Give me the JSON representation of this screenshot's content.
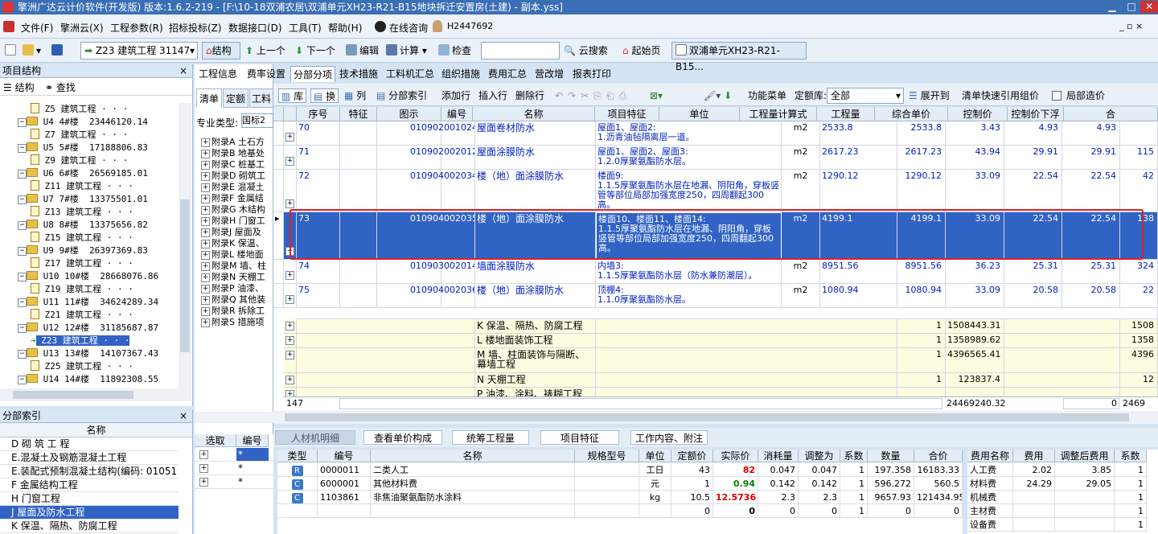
{
  "title": "擎洲广达云计价软件(开发版) 版本:1.6.2-219 - [F:\\10-18双浦农居\\双浦单元XH23-R21-B15地块拆迁安置房(土建) - 副本.yss]",
  "menu": [
    "文件(F)",
    "擎洲云(X)",
    "工程参数(R)",
    "招标投标(Z)",
    "数据接口(D)",
    "工具(T)",
    "帮助(H)",
    "在线咨询",
    "H2447692"
  ],
  "toolbar": {
    "project_select": "Z23 建筑工程 31147",
    "structure": "结构",
    "up": "上一个",
    "down": "下一个",
    "edit": "编辑",
    "calc": "计算",
    "check": "检查",
    "cloud_search": "云搜索",
    "home": "起始页",
    "doc_tab": "双浦单元XH23-R21-B15..."
  },
  "left_panel": {
    "title": "项目结构",
    "close": "×",
    "structure_btn": "结构",
    "find_btn": "查找",
    "tree": [
      {
        "code": "Z5",
        "name": "建筑工程",
        "amount": "· · ·",
        "indent": 3,
        "type": "doc"
      },
      {
        "code": "U4",
        "name": "4#楼",
        "amount": "23446120.14",
        "indent": 2,
        "type": "fld"
      },
      {
        "code": "Z7",
        "name": "建筑工程",
        "amount": "· · ·",
        "indent": 3,
        "type": "doc"
      },
      {
        "code": "U5",
        "name": "5#楼",
        "amount": "17188806.83",
        "indent": 2,
        "type": "fld"
      },
      {
        "code": "Z9",
        "name": "建筑工程",
        "amount": "· · ·",
        "indent": 3,
        "type": "doc"
      },
      {
        "code": "U6",
        "name": "6#楼",
        "amount": "26569185.01",
        "indent": 2,
        "type": "fld"
      },
      {
        "code": "Z11",
        "name": "建筑工程",
        "amount": "· · ·",
        "indent": 3,
        "type": "doc"
      },
      {
        "code": "U7",
        "name": "7#楼",
        "amount": "13375501.01",
        "indent": 2,
        "type": "fld"
      },
      {
        "code": "Z13",
        "name": "建筑工程",
        "amount": "· · ·",
        "indent": 3,
        "type": "doc"
      },
      {
        "code": "U8",
        "name": "8#楼",
        "amount": "13375656.82",
        "indent": 2,
        "type": "fld"
      },
      {
        "code": "Z15",
        "name": "建筑工程",
        "amount": "· · ·",
        "indent": 3,
        "type": "doc"
      },
      {
        "code": "U9",
        "name": "9#楼",
        "amount": "26397369.83",
        "indent": 2,
        "type": "fld"
      },
      {
        "code": "Z17",
        "name": "建筑工程",
        "amount": "· · ·",
        "indent": 3,
        "type": "doc"
      },
      {
        "code": "U10",
        "name": "10#楼",
        "amount": "28668076.86",
        "indent": 2,
        "type": "fld"
      },
      {
        "code": "Z19",
        "name": "建筑工程",
        "amount": "· · ·",
        "indent": 3,
        "type": "doc"
      },
      {
        "code": "U11",
        "name": "11#楼",
        "amount": "34624289.34",
        "indent": 2,
        "type": "fld"
      },
      {
        "code": "Z21",
        "name": "建筑工程",
        "amount": "· · ·",
        "indent": 3,
        "type": "doc"
      },
      {
        "code": "U12",
        "name": "12#楼",
        "amount": "31185687.87",
        "indent": 2,
        "type": "fld"
      },
      {
        "code": "Z23",
        "name": "建筑工程",
        "amount": "· · ·",
        "indent": 3,
        "type": "sel"
      },
      {
        "code": "U13",
        "name": "13#楼",
        "amount": "14107367.43",
        "indent": 2,
        "type": "fld"
      },
      {
        "code": "Z25",
        "name": "建筑工程",
        "amount": "· · ·",
        "indent": 3,
        "type": "doc"
      },
      {
        "code": "U14",
        "name": "14#楼",
        "amount": "11892308.55",
        "indent": 2,
        "type": "fld"
      }
    ]
  },
  "index_panel": {
    "title": "分部索引",
    "close": "×",
    "header": "名称",
    "rows": [
      "D 砌 筑 工 程",
      "E.混凝土及钢筋混凝土工程",
      "E.装配式预制混凝土结构(编码: 01051",
      "F 金属结构工程",
      "H 门窗工程",
      "J 屋面及防水工程",
      "K 保温、隔热、防腐工程"
    ],
    "selected": 5
  },
  "mid_panel": {
    "tabs": [
      "清单",
      "定额",
      "工料"
    ],
    "prof_label": "专业类型:",
    "prof_value": "国标2",
    "appendix": [
      "附录A 土石方",
      "附录B 地基处",
      "附录C 桩基工",
      "附录D 砌筑工",
      "附录E 混凝土",
      "附录F 金属结",
      "附录G 木结构",
      "附录H 门窗工",
      "附录J 屋面及",
      "附录K 保温、",
      "附录L 楼地面",
      "附录M 墙、柱",
      "附录N 天棚工",
      "附录P 油漆、",
      "附录Q 其他装",
      "附录R 拆除工",
      "附录S 措施项"
    ],
    "choose_header": [
      "选取",
      "编号"
    ],
    "choose_rows": [
      "*",
      "*",
      "*"
    ]
  },
  "main_tabs": [
    "工程信息",
    "费率设置",
    "分部分项",
    "技术措施",
    "工料机汇总",
    "组织措施",
    "费用汇总",
    "营改增",
    "报表打印"
  ],
  "main_tab_active": 2,
  "tb2": {
    "lib": "库",
    "swap": "换",
    "col": "列",
    "index": "分部索引",
    "add": "添加行",
    "insert": "插入行",
    "delete": "删除行",
    "func_menu": "功能菜单",
    "quota_lib_label": "定额库:",
    "quota_lib_value": "全部",
    "expand": "展开到",
    "quick_ref": "清单快速引用组价",
    "local_cost": "局部造价"
  },
  "grid": {
    "headers": [
      "序号",
      "特征",
      "图示",
      "编号",
      "名称",
      "项目特征",
      "单位",
      "工程量计算式",
      "工程量",
      "综合单价",
      "控制价",
      "控制价下浮",
      "合"
    ],
    "rows": [
      {
        "no": "70",
        "code": "010902001024",
        "name": "屋面卷材防水",
        "feature": "屋面1、屋面2:\n1.沥青油毡隔离层一道。",
        "unit": "m2",
        "formula": "2533.8",
        "qty": "2533.8",
        "price": "3.43",
        "ctrl": "4.93",
        "ctrl_down": "4.93",
        "total": ""
      },
      {
        "no": "71",
        "code": "010902002012",
        "name": "屋面涂膜防水",
        "feature": "屋面1、屋面2、屋面3:\n1.2.0厚聚氨酯防水层。",
        "unit": "m2",
        "formula": "2617.23",
        "qty": "2617.23",
        "price": "43.94",
        "ctrl": "29.91",
        "ctrl_down": "29.91",
        "total": "115"
      },
      {
        "no": "72",
        "code": "010904002034",
        "name": "楼（地）面涂膜防水",
        "feature": "楼面9:\n1.1.5厚聚氨酯防水层在地漏、阴阳角，穿板竖管等部位局部加强宽度250，四周翻起300高。",
        "unit": "m2",
        "formula": "1290.12",
        "qty": "1290.12",
        "price": "33.09",
        "ctrl": "22.54",
        "ctrl_down": "22.54",
        "total": "42"
      },
      {
        "no": "73",
        "code": "010904002035",
        "name": "楼（地）面涂膜防水",
        "feature": "楼面10、楼面11、楼面14:\n1.1.5厚聚氨酯防水层在地漏、阴阳角，穿板竖管等部位局部加强宽度250，四周翻起300高。",
        "unit": "m2",
        "formula": "4199.1",
        "qty": "4199.1",
        "price": "33.09",
        "ctrl": "22.54",
        "ctrl_down": "22.54",
        "total": "138"
      },
      {
        "no": "74",
        "code": "010903002014",
        "name": "墙面涂膜防水",
        "feature": "内墙3:\n1.1.5厚聚氨酯防水层（防水兼防潮层）。",
        "unit": "m2",
        "formula": "8951.56",
        "qty": "8951.56",
        "price": "36.23",
        "ctrl": "25.31",
        "ctrl_down": "25.31",
        "total": "324"
      },
      {
        "no": "75",
        "code": "010904002036",
        "name": "楼（地）面涂膜防水",
        "feature": "顶棚4:\n1.1.0厚聚氨酯防水层。",
        "unit": "m2",
        "formula": "1080.94",
        "qty": "1080.94",
        "price": "33.09",
        "ctrl": "20.58",
        "ctrl_down": "20.58",
        "total": "22"
      }
    ],
    "sections": [
      {
        "name": "K 保温、隔热、防腐工程",
        "qty": "1",
        "price": "1508443.31",
        "total": "1508"
      },
      {
        "name": "L 楼地面装饰工程",
        "qty": "1",
        "price": "1358989.62",
        "total": "1358"
      },
      {
        "name": "M 墙、柱面装饰与隔断、幕墙工程",
        "qty": "1",
        "price": "4396565.41",
        "total": "4396"
      },
      {
        "name": "N 天棚工程",
        "qty": "1",
        "price": "123837.4",
        "total": "12"
      },
      {
        "name": "P 油漆、涂料、裱糊工程",
        "qty": "",
        "price": "",
        "total": ""
      }
    ],
    "selected_index": 3
  },
  "status": {
    "count": "147",
    "sum": "24469240.32",
    "down": "0",
    "tail": "2469"
  },
  "bottom_tabs": [
    "人材机明细",
    "查看单价构成",
    "统筹工程量",
    "项目特征",
    "工作内容、附注"
  ],
  "bottom_grid": {
    "headers": [
      "类型",
      "编号",
      "名称",
      "规格型号",
      "单位",
      "定额价",
      "实际价",
      "消耗量",
      "调整为",
      "系数",
      "数量",
      "合价"
    ],
    "rows": [
      {
        "type": "R",
        "code": "0000011",
        "name": "二类人工",
        "spec": "",
        "unit": "工日",
        "quota": "43",
        "actual": "82",
        "consume": "0.047",
        "adjust": "0.047",
        "coef": "1",
        "amount": "197.358",
        "total": "16183.33",
        "actual_color": "#e00000"
      },
      {
        "type": "C",
        "code": "6000001",
        "name": "其他材料费",
        "spec": "",
        "unit": "元",
        "quota": "1",
        "actual": "0.94",
        "consume": "0.142",
        "adjust": "0.142",
        "coef": "1",
        "amount": "596.272",
        "total": "560.5",
        "actual_color": "#008000"
      },
      {
        "type": "C",
        "code": "1103861",
        "name": "非焦油聚氨酯防水涂料",
        "spec": "",
        "unit": "kg",
        "quota": "10.5",
        "actual": "12.5736",
        "consume": "2.3",
        "adjust": "2.3",
        "coef": "1",
        "amount": "9657.93",
        "total": "121434.95",
        "actual_color": "#e00000"
      },
      {
        "type": "",
        "code": "",
        "name": "",
        "spec": "",
        "unit": "",
        "quota": "0",
        "actual": "0",
        "consume": "0",
        "adjust": "0",
        "coef": "1",
        "amount": "0",
        "total": "0",
        "actual_color": "#000000"
      }
    ]
  },
  "fee_grid": {
    "headers": [
      "费用名称",
      "费用",
      "调整后费用",
      "系数"
    ],
    "rows": [
      {
        "name": "人工费",
        "fee": "2.02",
        "adj": "3.85",
        "coef": "1"
      },
      {
        "name": "材料费",
        "fee": "24.29",
        "adj": "29.05",
        "coef": "1"
      },
      {
        "name": "机械费",
        "fee": "",
        "adj": "",
        "coef": "1"
      },
      {
        "name": "主材费",
        "fee": "",
        "adj": "",
        "coef": "1"
      },
      {
        "name": "设备费",
        "fee": "",
        "adj": "",
        "coef": "1"
      }
    ]
  }
}
